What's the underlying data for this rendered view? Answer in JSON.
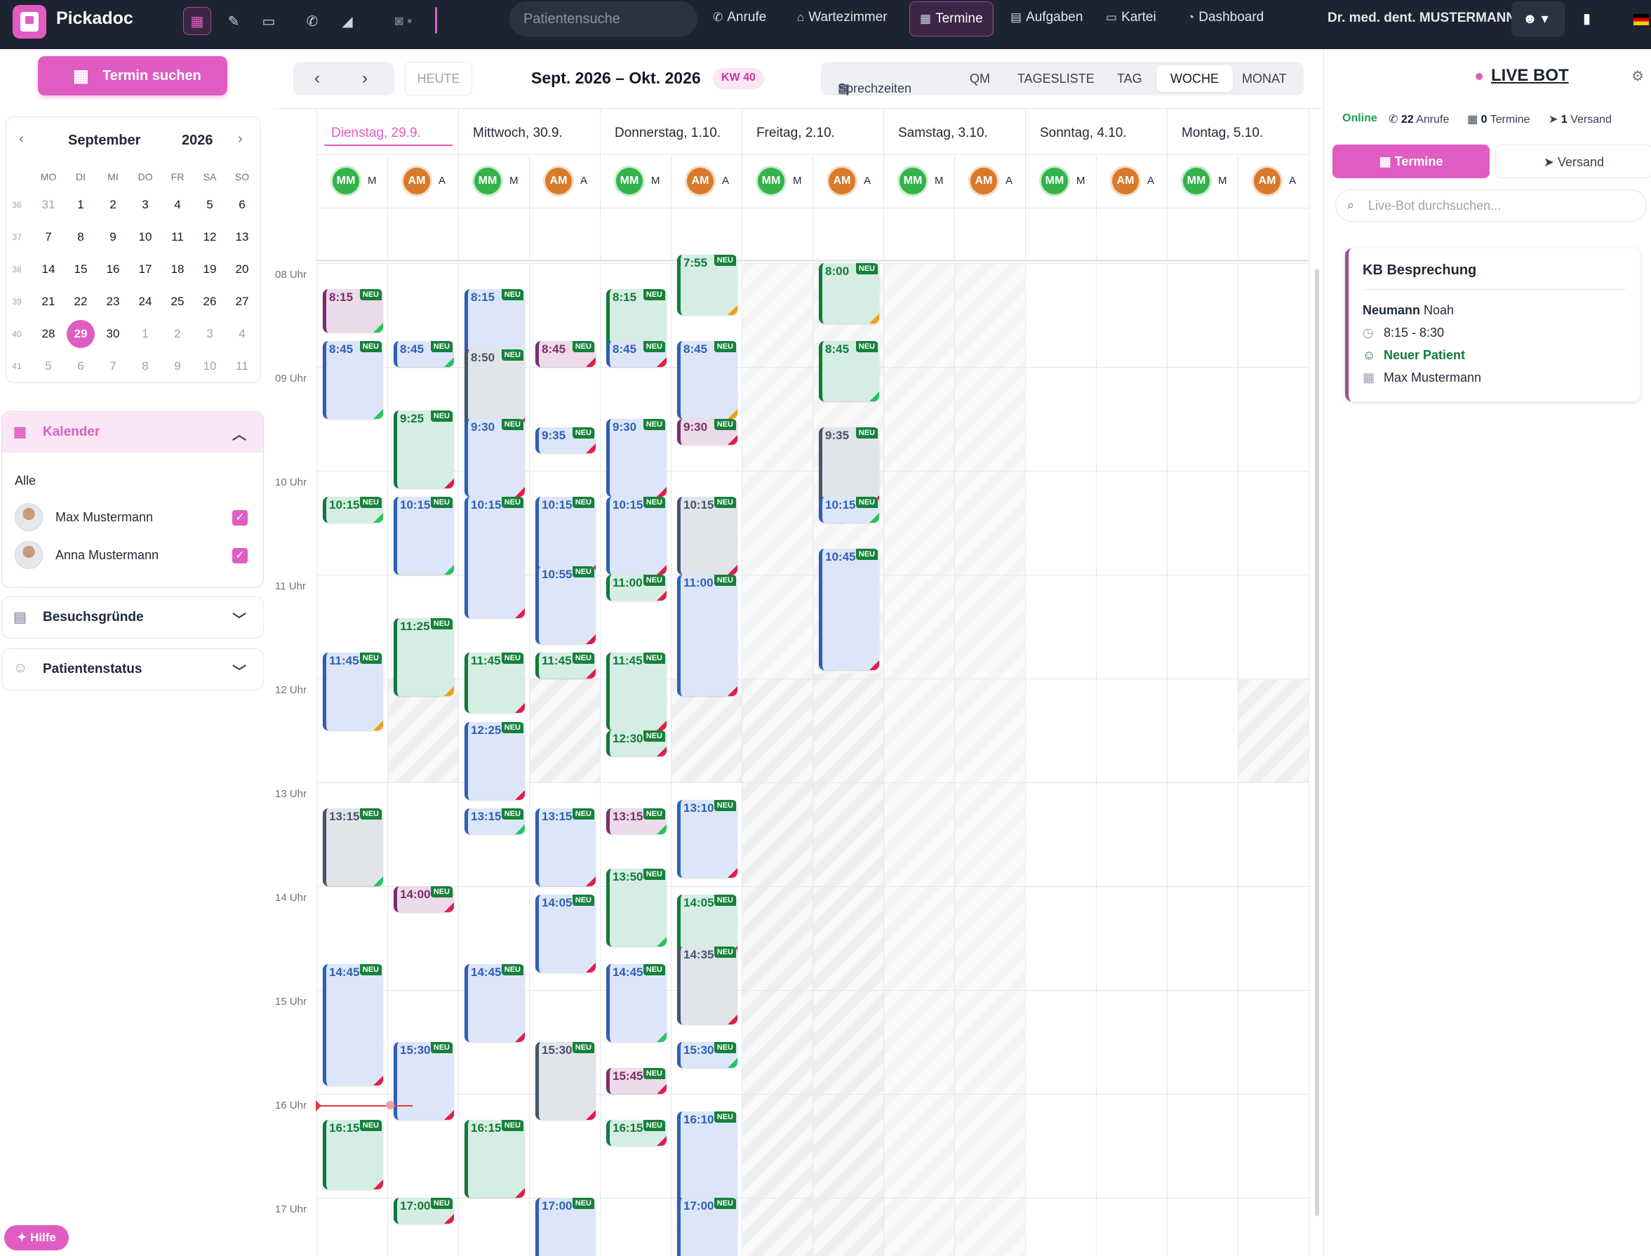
{
  "topbar": {
    "brand": "Pickadoc",
    "search_placeholder": "Patientensuche",
    "nav": [
      "Anrufe",
      "Wartezimmer",
      "Termine",
      "Aufgaben",
      "Kartei",
      "Dashboard"
    ],
    "active_nav": "Termine",
    "doctor": "Dr. med. dent. MUSTERMANN",
    "accent": "#e05cc2"
  },
  "sidebar": {
    "search_button": "Termin suchen",
    "minical": {
      "month": "September",
      "year": "2026",
      "weekdays": [
        "MO",
        "DI",
        "MI",
        "DO",
        "FR",
        "SA",
        "SO"
      ],
      "weeks": [
        {
          "wk": "36",
          "days": [
            "31",
            "1",
            "2",
            "3",
            "4",
            "5",
            "6"
          ]
        },
        {
          "wk": "37",
          "days": [
            "7",
            "8",
            "9",
            "10",
            "11",
            "12",
            "13"
          ]
        },
        {
          "wk": "38",
          "days": [
            "14",
            "15",
            "16",
            "17",
            "18",
            "19",
            "20"
          ]
        },
        {
          "wk": "39",
          "days": [
            "21",
            "22",
            "23",
            "24",
            "25",
            "26",
            "27"
          ]
        },
        {
          "wk": "40",
          "days": [
            "28",
            "29",
            "30",
            "1",
            "2",
            "3",
            "4"
          ]
        },
        {
          "wk": "41",
          "days": [
            "5",
            "6",
            "7",
            "8",
            "9",
            "10",
            "11"
          ]
        }
      ],
      "today": "29"
    },
    "kalender": {
      "title": "Kalender",
      "all_label": "Alle",
      "people": [
        "Max Mustermann",
        "Anna Mustermann"
      ]
    },
    "besuchsgruende": "Besuchsgründe",
    "patientenstatus": "Patientenstatus",
    "help": "Hilfe"
  },
  "toolbar": {
    "today": "HEUTE",
    "range": "Sept. 2026 – Okt. 2026",
    "kw": "KW 40",
    "views": [
      "Sprechzeiten",
      "QM",
      "TAGESLISTE",
      "TAG",
      "WOCHE",
      "MONAT"
    ],
    "active_view": "WOCHE"
  },
  "calendar": {
    "days": [
      "Dienstag, 29.9.",
      "Mittwoch, 30.9.",
      "Donnerstag, 1.10.",
      "Freitag, 2.10.",
      "Samstag, 3.10.",
      "Sonntag, 4.10.",
      "Montag, 5.10."
    ],
    "resources": [
      "MM",
      "AM"
    ],
    "hours": [
      "08 Uhr",
      "09 Uhr",
      "10 Uhr",
      "11 Uhr",
      "12 Uhr",
      "13 Uhr",
      "14 Uhr",
      "15 Uhr",
      "16 Uhr",
      "17 Uhr"
    ],
    "badge": "NEU",
    "events": [
      {
        "c": 0,
        "t": "8:15",
        "k": "p",
        "m": "g",
        "d": 25
      },
      {
        "c": 0,
        "t": "8:45",
        "k": "b",
        "m": "g",
        "d": 45
      },
      {
        "c": 0,
        "t": "10:15",
        "k": "g",
        "m": "g",
        "d": 15
      },
      {
        "c": 0,
        "t": "11:45",
        "k": "b",
        "m": "o",
        "d": 45
      },
      {
        "c": 0,
        "t": "13:15",
        "k": "s",
        "m": "g",
        "d": 45
      },
      {
        "c": 0,
        "t": "14:45",
        "k": "b",
        "m": "r",
        "d": 70
      },
      {
        "c": 0,
        "t": "16:15",
        "k": "g",
        "m": "r",
        "d": 40
      },
      {
        "c": 1,
        "t": "8:45",
        "k": "b",
        "m": "g",
        "d": 15
      },
      {
        "c": 1,
        "t": "9:25",
        "k": "g",
        "m": "r",
        "d": 45
      },
      {
        "c": 1,
        "t": "10:15",
        "k": "b",
        "m": "g",
        "d": 45
      },
      {
        "c": 1,
        "t": "11:25",
        "k": "g",
        "m": "o",
        "d": 45
      },
      {
        "c": 1,
        "t": "14:00",
        "k": "p",
        "m": "r",
        "d": 15
      },
      {
        "c": 1,
        "t": "15:30",
        "k": "b",
        "m": "r",
        "d": 45
      },
      {
        "c": 1,
        "t": "17:00",
        "k": "g",
        "m": "r",
        "d": 15
      },
      {
        "c": 2,
        "t": "8:15",
        "k": "b",
        "m": "r",
        "d": 45
      },
      {
        "c": 2,
        "t": "8:50",
        "k": "s",
        "m": "r",
        "d": 45
      },
      {
        "c": 2,
        "t": "9:30",
        "k": "b",
        "m": "r",
        "d": 45
      },
      {
        "c": 2,
        "t": "10:15",
        "k": "b",
        "m": "r",
        "d": 70
      },
      {
        "c": 2,
        "t": "11:45",
        "k": "g",
        "m": "r",
        "d": 35
      },
      {
        "c": 2,
        "t": "12:25",
        "k": "b",
        "m": "r",
        "d": 45
      },
      {
        "c": 2,
        "t": "13:15",
        "k": "b",
        "m": "g",
        "d": 15
      },
      {
        "c": 2,
        "t": "14:45",
        "k": "b",
        "m": "r",
        "d": 45
      },
      {
        "c": 2,
        "t": "16:15",
        "k": "g",
        "m": "r",
        "d": 45
      },
      {
        "c": 3,
        "t": "8:45",
        "k": "p",
        "m": "r",
        "d": 15
      },
      {
        "c": 3,
        "t": "9:35",
        "k": "b",
        "m": "r",
        "d": 15
      },
      {
        "c": 3,
        "t": "10:15",
        "k": "b",
        "m": "r",
        "d": 45
      },
      {
        "c": 3,
        "t": "10:55",
        "k": "b",
        "m": "r",
        "d": 45
      },
      {
        "c": 3,
        "t": "11:45",
        "k": "g",
        "m": "r",
        "d": 15
      },
      {
        "c": 3,
        "t": "13:15",
        "k": "b",
        "m": "r",
        "d": 45
      },
      {
        "c": 3,
        "t": "14:05",
        "k": "b",
        "m": "r",
        "d": 45
      },
      {
        "c": 3,
        "t": "15:30",
        "k": "s",
        "m": "r",
        "d": 45
      },
      {
        "c": 3,
        "t": "17:00",
        "k": "b",
        "m": "r",
        "d": 45
      },
      {
        "c": 4,
        "t": "8:15",
        "k": "g",
        "m": "o",
        "d": 40
      },
      {
        "c": 4,
        "t": "8:45",
        "k": "b",
        "m": "r",
        "d": 15
      },
      {
        "c": 4,
        "t": "9:30",
        "k": "b",
        "m": "r",
        "d": 45
      },
      {
        "c": 4,
        "t": "10:15",
        "k": "b",
        "m": "r",
        "d": 45
      },
      {
        "c": 4,
        "t": "11:00",
        "k": "g",
        "m": "r",
        "d": 15
      },
      {
        "c": 4,
        "t": "11:45",
        "k": "g",
        "m": "r",
        "d": 45
      },
      {
        "c": 4,
        "t": "12:30",
        "k": "g",
        "m": "r",
        "d": 15
      },
      {
        "c": 4,
        "t": "13:15",
        "k": "p",
        "m": "g",
        "d": 15
      },
      {
        "c": 4,
        "t": "13:50",
        "k": "g",
        "m": "g",
        "d": 45
      },
      {
        "c": 4,
        "t": "14:45",
        "k": "b",
        "m": "g",
        "d": 45
      },
      {
        "c": 4,
        "t": "15:45",
        "k": "p",
        "m": "r",
        "d": 15
      },
      {
        "c": 4,
        "t": "16:15",
        "k": "g",
        "m": "r",
        "d": 15
      },
      {
        "c": 5,
        "t": "7:55",
        "k": "g",
        "m": "o",
        "d": 35
      },
      {
        "c": 5,
        "t": "8:45",
        "k": "b",
        "m": "o",
        "d": 45
      },
      {
        "c": 5,
        "t": "9:30",
        "k": "p",
        "m": "r",
        "d": 15
      },
      {
        "c": 5,
        "t": "10:15",
        "k": "s",
        "m": "r",
        "d": 45
      },
      {
        "c": 5,
        "t": "11:00",
        "k": "b",
        "m": "r",
        "d": 70
      },
      {
        "c": 5,
        "t": "13:10",
        "k": "b",
        "m": "r",
        "d": 45
      },
      {
        "c": 5,
        "t": "14:05",
        "k": "g",
        "m": "r",
        "d": 35
      },
      {
        "c": 5,
        "t": "14:35",
        "k": "s",
        "m": "r",
        "d": 45
      },
      {
        "c": 5,
        "t": "15:30",
        "k": "b",
        "m": "g",
        "d": 15
      },
      {
        "c": 5,
        "t": "16:10",
        "k": "b",
        "m": "r",
        "d": 70
      },
      {
        "c": 5,
        "t": "17:00",
        "k": "b",
        "m": "g",
        "d": 45
      },
      {
        "c": 7,
        "t": "8:00",
        "k": "g",
        "m": "o",
        "d": 35
      },
      {
        "c": 7,
        "t": "8:45",
        "k": "g",
        "m": "g",
        "d": 35
      },
      {
        "c": 7,
        "t": "9:35",
        "k": "s",
        "m": "r",
        "d": 45
      },
      {
        "c": 7,
        "t": "10:15",
        "k": "b",
        "m": "g",
        "d": 15
      },
      {
        "c": 7,
        "t": "10:45",
        "k": "b",
        "m": "r",
        "d": 70
      }
    ]
  },
  "livebot": {
    "title": "LIVE BOT",
    "status": "Online",
    "calls_count": "22",
    "calls_label": "Anrufe",
    "appointments_count": "0",
    "appointments_label": "Termine",
    "dispatch_count": "1",
    "dispatch_label": "Versand",
    "tabs": [
      "Termine",
      "Versand"
    ],
    "search_placeholder": "Live-Bot durchsuchen...",
    "card": {
      "title": "KB Besprechung",
      "last_name": "Neumann",
      "first_name": "Noah",
      "time": "8:15 - 8:30",
      "status": "Neuer Patient",
      "doctor": "Max Mustermann"
    }
  }
}
